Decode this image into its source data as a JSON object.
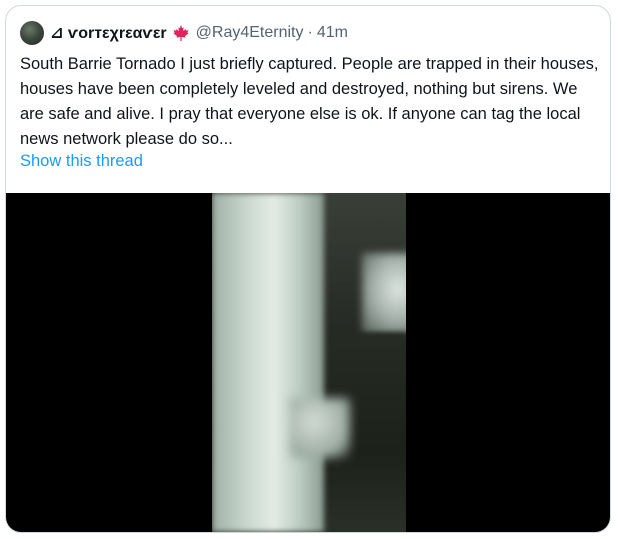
{
  "tweet": {
    "display_name": "⊿ ѵоrтεχrεαѵεr",
    "flag_icon": "canada-flag-icon",
    "handle": "@Ray4Eternity",
    "separator": "·",
    "time": "41m",
    "text": "South Barrie Tornado I just briefly captured. People are trapped in their houses, houses have been completely leveled and destroyed, nothing but sirens. We are safe and alive. I pray that everyone else is ok. If anyone can tag the local news network please do so...",
    "thread_link": "Show this thread"
  },
  "colors": {
    "text": "#0f1419",
    "secondary": "#536471",
    "link": "#1d9bf0",
    "border": "#cfd9de",
    "media_bg": "#000000",
    "flag_red": "#e0245e"
  }
}
